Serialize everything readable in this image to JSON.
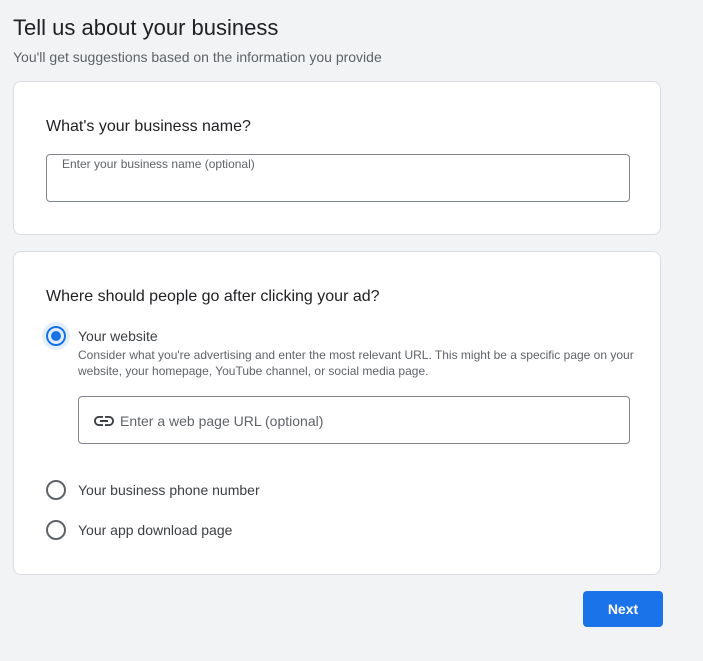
{
  "header": {
    "title": "Tell us about your business",
    "subtitle": "You'll get suggestions based on the information you provide"
  },
  "business_name_card": {
    "heading": "What's your business name?",
    "input_label": "Enter your business name (optional)",
    "input_value": ""
  },
  "destination_card": {
    "heading": "Where should people go after clicking your ad?",
    "selected": "website",
    "options": [
      {
        "id": "website",
        "label": "Your website",
        "description": "Consider what you're advertising and enter the most relevant URL. This might be a specific page on your website, your homepage, YouTube channel, or social media page."
      },
      {
        "id": "phone",
        "label": "Your business phone number"
      },
      {
        "id": "app",
        "label": "Your app download page"
      }
    ],
    "url_input": {
      "icon": "link-icon",
      "placeholder": "Enter a web page URL (optional)",
      "value": ""
    }
  },
  "footer": {
    "next_label": "Next"
  },
  "colors": {
    "accent": "#1a73e8",
    "background": "#f1f3f4",
    "card": "#ffffff",
    "border": "#dadce0"
  }
}
